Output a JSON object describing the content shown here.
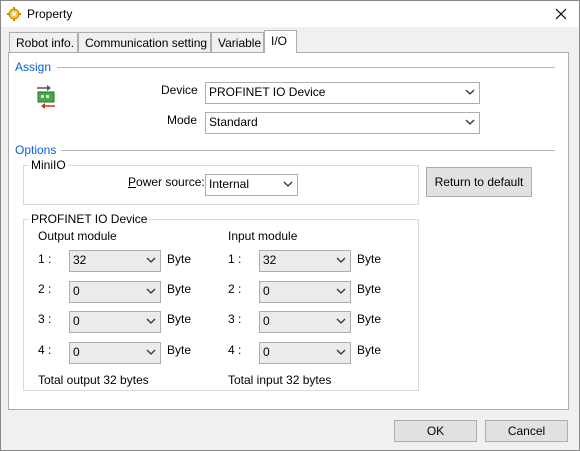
{
  "window": {
    "title": "Property",
    "close_icon": "close-icon"
  },
  "tabs": [
    {
      "label": "Robot info."
    },
    {
      "label": "Communication setting"
    },
    {
      "label": "Variable"
    },
    {
      "label": "I/O",
      "active": true
    }
  ],
  "assign": {
    "heading": "Assign",
    "device_label": "Device",
    "device_value": "PROFINET IO Device",
    "mode_label": "Mode",
    "mode_value": "Standard"
  },
  "options": {
    "heading": "Options",
    "minio": {
      "title": "MiniIO",
      "power_source_label_prefix": "P",
      "power_source_label_rest": "ower source:",
      "power_source_value": "Internal"
    },
    "return_default_label": "Return to default",
    "profinet": {
      "title": "PROFINET IO Device",
      "output": {
        "heading": "Output module",
        "rows": [
          {
            "index": "1 :",
            "value": "32",
            "unit": "Byte"
          },
          {
            "index": "2 :",
            "value": "0",
            "unit": "Byte"
          },
          {
            "index": "3 :",
            "value": "0",
            "unit": "Byte"
          },
          {
            "index": "4 :",
            "value": "0",
            "unit": "Byte"
          }
        ],
        "total": "Total output 32 bytes"
      },
      "input": {
        "heading": "Input module",
        "rows": [
          {
            "index": "1 :",
            "value": "32",
            "unit": "Byte"
          },
          {
            "index": "2 :",
            "value": "0",
            "unit": "Byte"
          },
          {
            "index": "3 :",
            "value": "0",
            "unit": "Byte"
          },
          {
            "index": "4 :",
            "value": "0",
            "unit": "Byte"
          }
        ],
        "total": "Total input 32 bytes"
      }
    }
  },
  "footer": {
    "ok_label": "OK",
    "cancel_label": "Cancel"
  },
  "colors": {
    "section_heading": "#0b5ed7",
    "window_bg": "#f0f0f0",
    "panel_bg": "#ffffff"
  }
}
